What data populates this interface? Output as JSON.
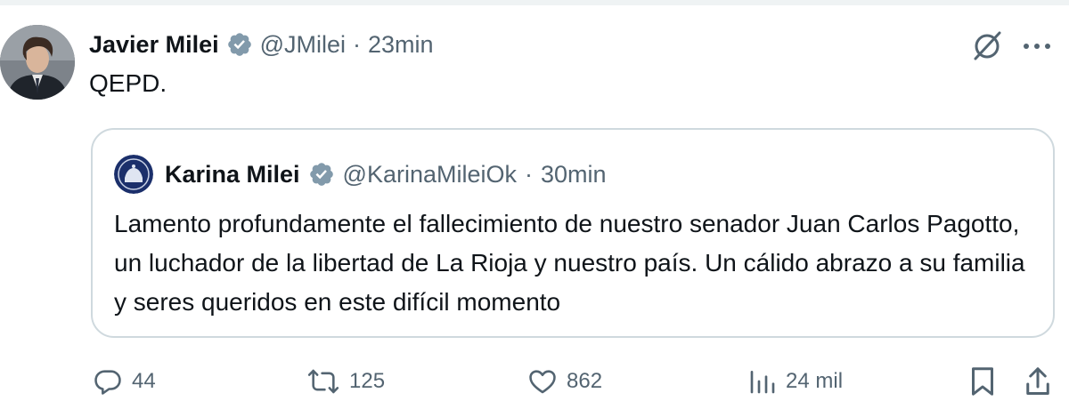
{
  "author": {
    "name": "Javier Milei",
    "handle": "@JMilei",
    "separator": "·",
    "time": "23min"
  },
  "post": {
    "text": "QEPD."
  },
  "quoted": {
    "name": "Karina Milei",
    "handle": "@KarinaMileiOk",
    "separator": "·",
    "time": "30min",
    "text": "Lamento profundamente el fallecimiento de nuestro senador Juan Carlos Pagotto, un luchador de la libertad de La Rioja y nuestro país. Un cálido abrazo a su familia y seres queridos en este difícil momento"
  },
  "actions": {
    "replies": "44",
    "reposts": "125",
    "likes": "862",
    "views": "24 mil"
  },
  "colors": {
    "verified": "#829aab",
    "text": "#0f1419",
    "muted": "#536471",
    "border": "#cfd9de"
  },
  "icons": [
    "grok-icon",
    "more-icon",
    "reply-icon",
    "repost-icon",
    "like-icon",
    "views-icon",
    "bookmark-icon",
    "share-icon"
  ]
}
